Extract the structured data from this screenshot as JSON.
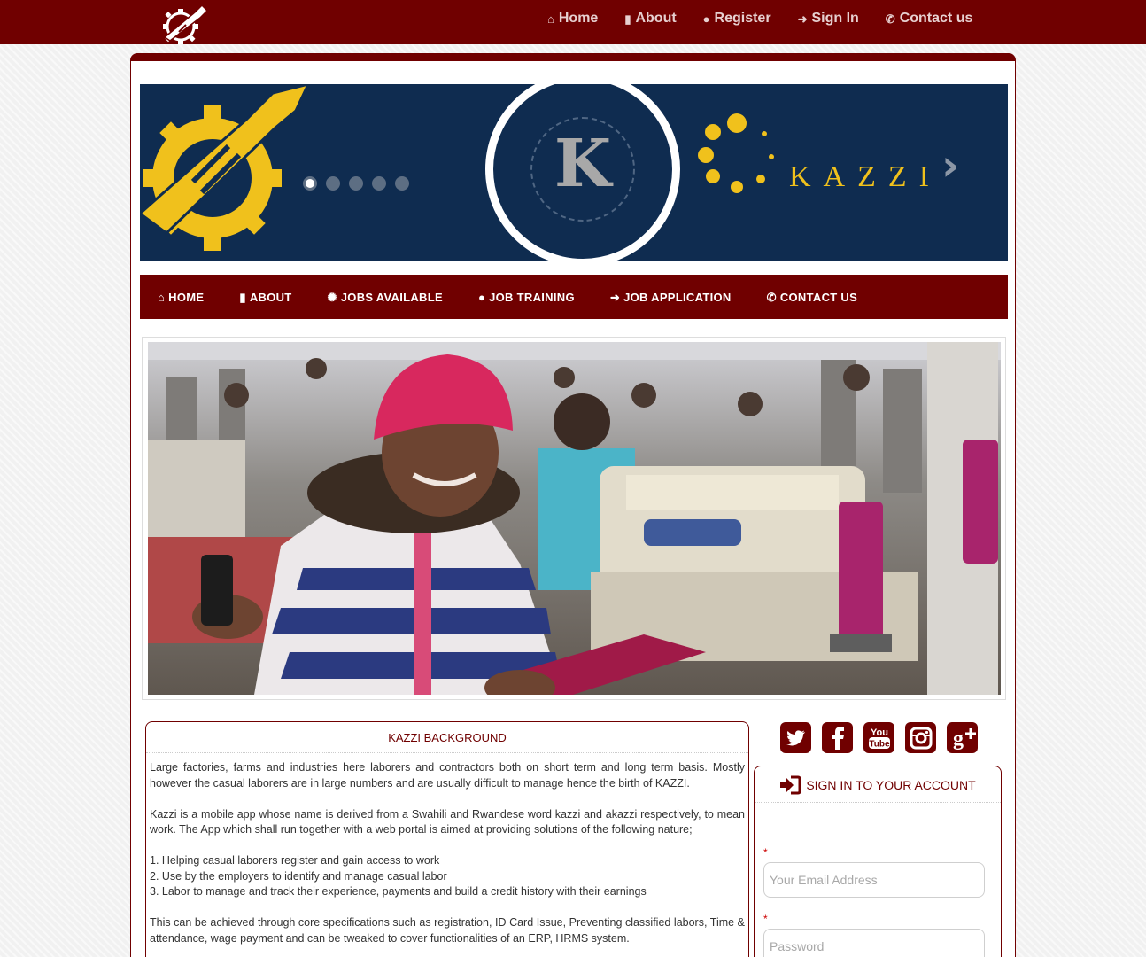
{
  "top_nav": {
    "items": [
      {
        "label": "Home",
        "icon": "home-icon"
      },
      {
        "label": "About",
        "icon": "file-icon"
      },
      {
        "label": "Register",
        "icon": "user-icon"
      },
      {
        "label": "Sign In",
        "icon": "sign-in-icon"
      },
      {
        "label": "Contact us",
        "icon": "phone-icon"
      }
    ]
  },
  "banner": {
    "letter": "K",
    "brand": "KAZZI",
    "slides_total": 5,
    "active_slide": 1
  },
  "main_nav": {
    "items": [
      {
        "label": "HOME",
        "icon": "home-icon"
      },
      {
        "label": "ABOUT",
        "icon": "file-icon"
      },
      {
        "label": "JOBS AVAILABLE",
        "icon": "spinner-icon"
      },
      {
        "label": "JOB TRAINING",
        "icon": "user-icon"
      },
      {
        "label": "JOB APPLICATION",
        "icon": "sign-in-icon"
      },
      {
        "label": "CONTACT US",
        "icon": "phone-icon"
      }
    ]
  },
  "background": {
    "title": "KAZZI BACKGROUND",
    "p1": "Large factories, farms and industries here laborers and contractors both on short term and long term basis. Mostly however the casual laborers are in large numbers and are usually difficult to manage hence the birth of KAZZI.",
    "p2": "Kazzi is a mobile app whose name is derived from a Swahili and Rwandese word kazzi and akazzi respectively, to mean work. The App which shall run together with a web portal is aimed at providing solutions of the following nature;",
    "list": [
      "1. Helping casual laborers register and gain access to work",
      "2. Use by the employers to identify and manage casual labor",
      "3. Labor to manage and track their experience, payments and build a credit history with their earnings"
    ],
    "p3": "This can be achieved through core specifications such as registration, ID Card Issue, Preventing classified labors, Time & attendance, wage payment and can be tweaked to cover functionalities of an ERP, HRMS system."
  },
  "social": [
    "twitter-icon",
    "facebook-icon",
    "youtube-icon",
    "instagram-icon",
    "google-plus-icon"
  ],
  "signin": {
    "title": "SIGN IN TO YOUR ACCOUNT",
    "required_mark": "*",
    "email_placeholder": "Your Email Address",
    "password_placeholder": "Password"
  },
  "colors": {
    "brand_maroon": "#700000",
    "banner_navy": "#0f2c50",
    "brand_yellow": "#f0c11c"
  }
}
